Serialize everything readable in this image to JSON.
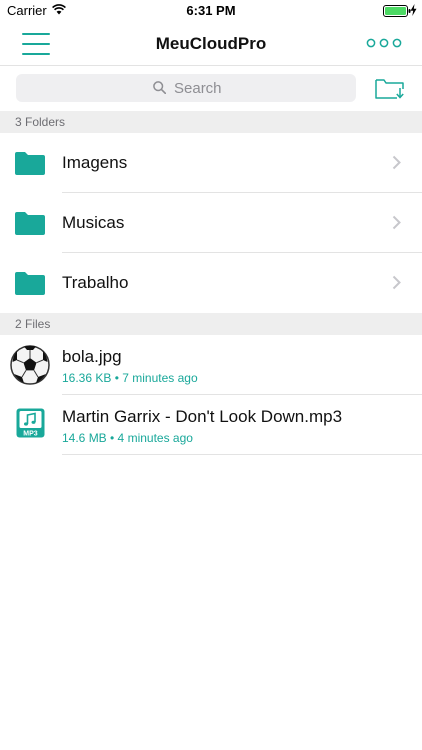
{
  "status_bar": {
    "carrier": "Carrier",
    "time": "6:31 PM"
  },
  "nav": {
    "title": "MeuCloudPro",
    "menu_icon": "hamburger-menu-icon",
    "more_icon": "more-dots-icon"
  },
  "search": {
    "placeholder": "Search",
    "new_folder_icon": "new-folder-download-icon"
  },
  "folders_section": {
    "header": "3 Folders",
    "items": [
      {
        "label": "Imagens"
      },
      {
        "label": "Musicas"
      },
      {
        "label": "Trabalho"
      }
    ]
  },
  "files_section": {
    "header": "2 Files",
    "items": [
      {
        "label": "bola.jpg",
        "meta": "16.36 KB • 7 minutes ago",
        "icon": "soccer-ball-thumbnail"
      },
      {
        "label": "Martin Garrix - Don't Look Down.mp3",
        "meta": "14.6 MB • 4 minutes ago",
        "icon": "mp3-file-icon"
      }
    ]
  },
  "colors": {
    "accent": "#19a89a",
    "battery": "#4cd964"
  }
}
